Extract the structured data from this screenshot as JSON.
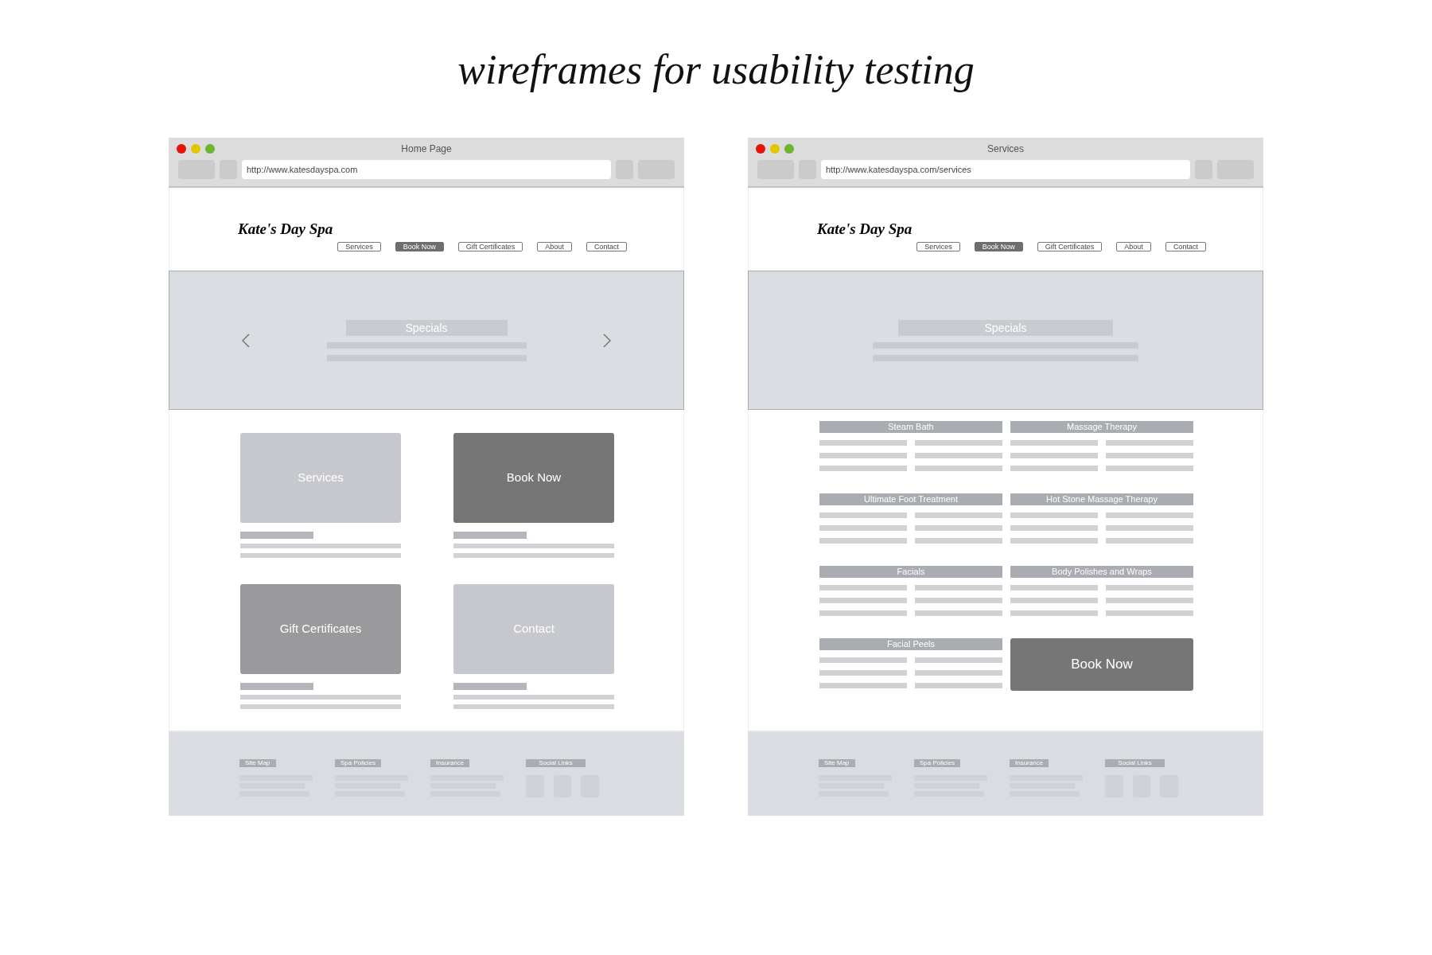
{
  "heading": "wireframes for usability testing",
  "windows": [
    {
      "kind": "home",
      "title": "Home Page",
      "url": "http://www.katesdayspa.com",
      "logo": "Kate's Day Spa",
      "nav": [
        {
          "label": "Services",
          "selected": false
        },
        {
          "label": "Book Now",
          "selected": true
        },
        {
          "label": "Gift Certificates",
          "selected": false
        },
        {
          "label": "About",
          "selected": false
        },
        {
          "label": "Contact",
          "selected": false
        }
      ],
      "hero": {
        "title": "Specials",
        "arrows": true
      },
      "tiles": [
        {
          "label": "Services",
          "color": "#c6c8cd"
        },
        {
          "label": "Book Now",
          "color": "#767676"
        },
        {
          "label": "Gift Certificates",
          "color": "#9a9a9c"
        },
        {
          "label": "Contact",
          "color": "#c6c8cd"
        }
      ],
      "footer": [
        {
          "label": "Site Map",
          "kind": "links"
        },
        {
          "label": "Spa Policies",
          "kind": "links"
        },
        {
          "label": "Insurance",
          "kind": "links"
        },
        {
          "label": "Social Links",
          "kind": "social"
        }
      ]
    },
    {
      "kind": "services",
      "title": "Services",
      "url": "http://www.katesdayspa.com/services",
      "logo": "Kate's Day Spa",
      "nav": [
        {
          "label": "Services",
          "selected": false
        },
        {
          "label": "Book Now",
          "selected": true
        },
        {
          "label": "Gift Certificates",
          "selected": false
        },
        {
          "label": "About",
          "selected": false
        },
        {
          "label": "Contact",
          "selected": false
        }
      ],
      "hero": {
        "title": "Specials",
        "arrows": false
      },
      "sections": [
        {
          "title": "Steam Bath"
        },
        {
          "title": "Massage Therapy"
        },
        {
          "title": "Ultimate Foot Treatment"
        },
        {
          "title": "Hot Stone Massage Therapy"
        },
        {
          "title": "Facials"
        },
        {
          "title": "Body Polishes and Wraps"
        },
        {
          "title": "Facial Peels"
        }
      ],
      "cta": "Book Now",
      "footer": [
        {
          "label": "Site Map",
          "kind": "links"
        },
        {
          "label": "Spa Policies",
          "kind": "links"
        },
        {
          "label": "Insurance",
          "kind": "links"
        },
        {
          "label": "Social Links",
          "kind": "social"
        }
      ]
    }
  ]
}
